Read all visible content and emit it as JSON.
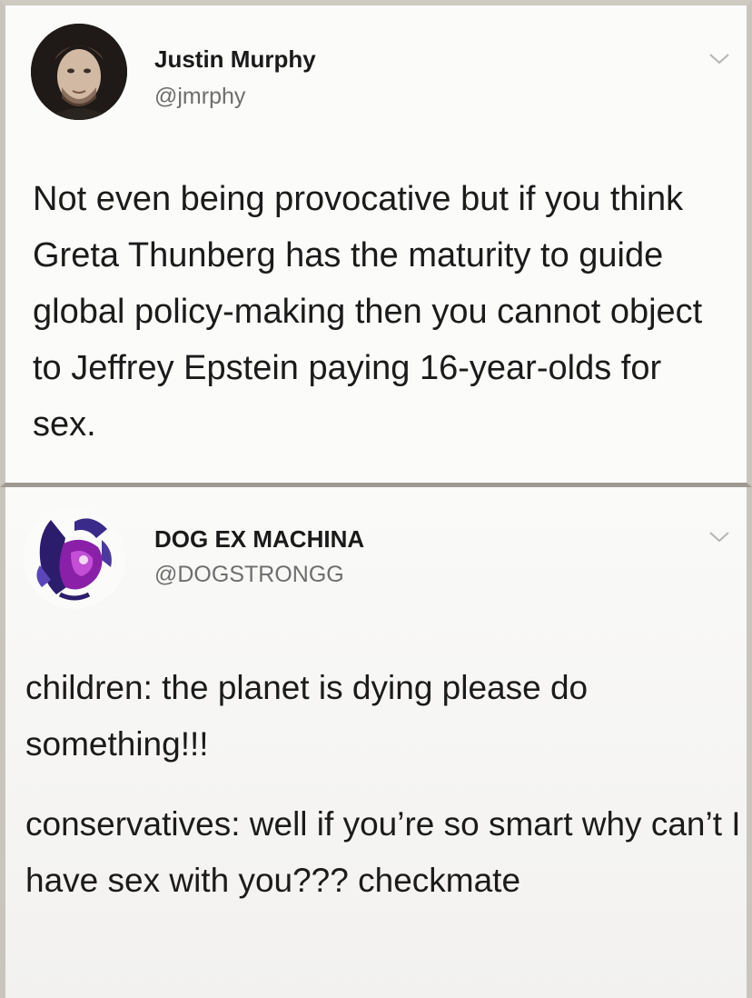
{
  "tweets": [
    {
      "display_name": "Justin Murphy",
      "handle": "@jmrphy",
      "icons": {
        "avatar": "profile-photo",
        "menu": "chevron-down-icon"
      },
      "text": "Not even being provocative but if you think Greta Thunberg has the maturity to guide global policy-making then you cannot object to Jeffrey Epstein paying 16-year-olds for sex."
    },
    {
      "display_name": "DOG EX MACHINA",
      "handle": "@DOGSTRONGG",
      "icons": {
        "avatar": "dog-avatar",
        "menu": "chevron-down-icon"
      },
      "paragraphs": [
        "children: the planet is dying please do something!!!",
        "conservatives: well if you’re so smart why can’t I have sex with you??? checkmate"
      ]
    }
  ],
  "colors": {
    "background": "#fbfbfa",
    "text": "#1b1b1b",
    "secondary_text": "#6e6e6e",
    "divider": "#9e9a93"
  }
}
